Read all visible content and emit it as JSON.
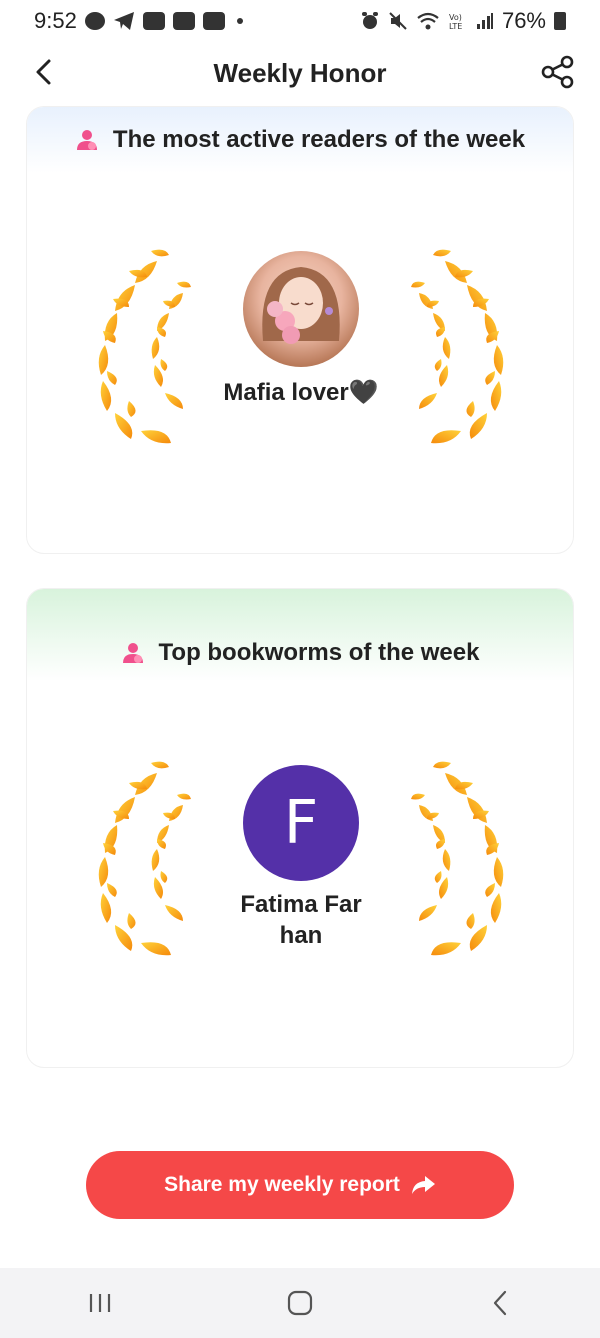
{
  "status_bar": {
    "time": "9:52",
    "battery": "76%",
    "left_icons": [
      "chat-icon",
      "telegram-icon",
      "youtube-icon",
      "youtube-icon",
      "youtube-icon"
    ],
    "right_icons": [
      "alarm-icon",
      "mute-icon",
      "wifi-icon",
      "volte-icon",
      "signal-icon",
      "battery-icon"
    ]
  },
  "header": {
    "title": "Weekly Honor",
    "back_icon": "chevron-left-icon",
    "share_icon": "share-icon"
  },
  "sections": [
    {
      "title": "The most active readers of the week",
      "icon": "person-icon",
      "header_color": "#e8f1fd",
      "user": {
        "name": "Mafia lover🖤",
        "avatar_type": "photo"
      }
    },
    {
      "title": "Top bookworms of the week",
      "icon": "person-icon",
      "header_color": "#d8f3dc",
      "user": {
        "name": "Fatima Farhan",
        "avatar_letter": "F",
        "avatar_color": "#5430a8"
      }
    }
  ],
  "share_button": {
    "label": "Share my weekly report",
    "color": "#f54848",
    "icon": "share-arrow-icon"
  },
  "nav_bar": {
    "icons": [
      "recents-icon",
      "home-icon",
      "back-icon"
    ]
  }
}
